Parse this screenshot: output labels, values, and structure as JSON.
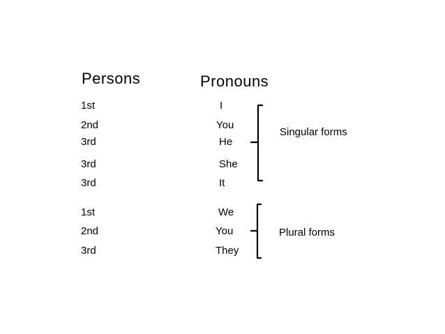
{
  "headers": {
    "persons": "Persons",
    "pronouns": "Pronouns"
  },
  "singular": {
    "label": "Singular forms",
    "rows": [
      {
        "person": "1st",
        "pronoun": "I"
      },
      {
        "person": "2nd",
        "pronoun": "You"
      },
      {
        "person": "3rd",
        "pronoun": "He"
      },
      {
        "person": "3rd",
        "pronoun": "She"
      },
      {
        "person": "3rd",
        "pronoun": "It"
      }
    ]
  },
  "plural": {
    "label": "Plural forms",
    "rows": [
      {
        "person": "1st",
        "pronoun": "We"
      },
      {
        "person": "2nd",
        "pronoun": "You"
      },
      {
        "person": "3rd",
        "pronoun": "They"
      }
    ]
  }
}
